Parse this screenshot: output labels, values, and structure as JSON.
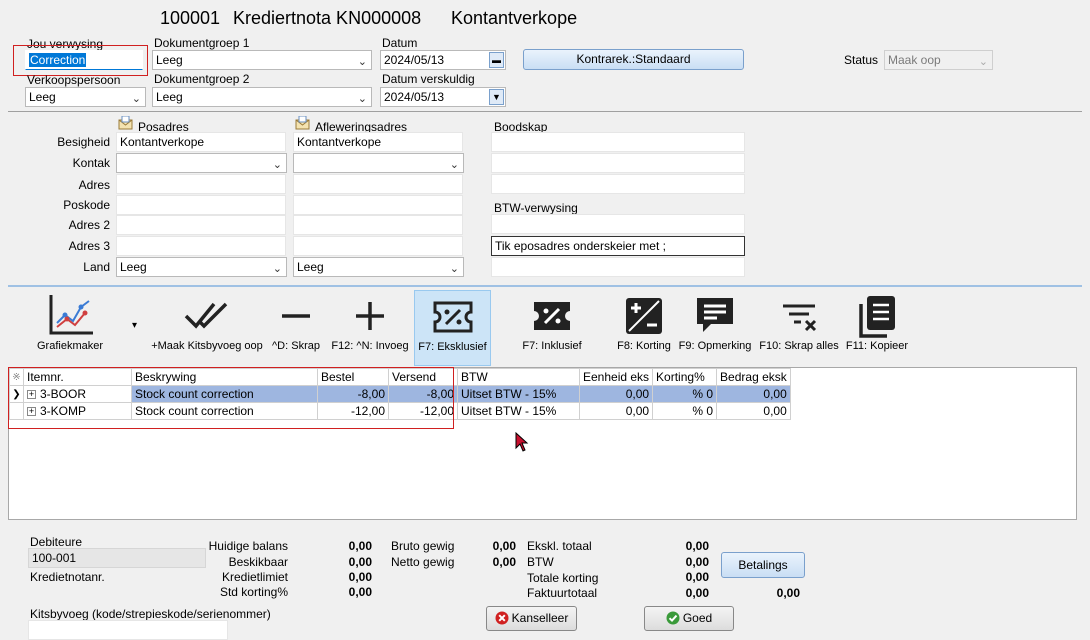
{
  "title": {
    "number": "100001",
    "doc": "Krediertnota KN000008",
    "customer": "Kontantverkope"
  },
  "header": {
    "jou_verwysing_label": "Jou verwysing",
    "jou_verwysing_value": "Correction",
    "verkoopspersoon_label": "Verkoopspersoon",
    "verkoopspersoon_value": "Leeg",
    "dokumentgroep1_label": "Dokumentgroep 1",
    "dokumentgroep1_value": "Leeg",
    "dokumentgroep2_label": "Dokumentgroep 2",
    "dokumentgroep2_value": "Leeg",
    "datum_label": "Datum",
    "datum_value": "2024/05/13",
    "datum_verskuldig_label": "Datum verskuldig",
    "datum_verskuldig_value": "2024/05/13",
    "kontrarek_button": "Kontrarek.:Standaard",
    "status_label": "Status",
    "status_value": "Maak oop"
  },
  "address": {
    "posadres": "Posadres",
    "afleweringsadres": "Afleweringsadres",
    "besigheid_label": "Besigheid",
    "besigheid_post": "Kontantverkope",
    "besigheid_deliv": "Kontantverkope",
    "kontak_label": "Kontak",
    "adres_label": "Adres",
    "poskode_label": "Poskode",
    "adres2_label": "Adres 2",
    "adres3_label": "Adres 3",
    "land_label": "Land",
    "land_post": "Leeg",
    "land_deliv": "Leeg",
    "boodskap_label": "Boodskap",
    "btw_verwysing_label": "BTW-verwysing",
    "eposadres_hint": "Tik eposadres onderskeier met ;"
  },
  "toolbar": [
    {
      "name": "grafiekmaker",
      "label": "Grafiekmaker",
      "icon": "chart-icon"
    },
    {
      "name": "maak-kitsbyvoeg",
      "label": "+Maak Kitsbyvoeg oop",
      "icon": "double-check-icon"
    },
    {
      "name": "skrap",
      "label": "^D: Skrap",
      "icon": "minus-icon"
    },
    {
      "name": "invoeg",
      "label": "F12: ^N: Invoeg",
      "icon": "plus-icon"
    },
    {
      "name": "eksklusief",
      "label": "F7: Eksklusief",
      "icon": "percent-ticket-icon"
    },
    {
      "name": "inklusief",
      "label": "F7: Inklusief",
      "icon": "percent-ticket-filled-icon"
    },
    {
      "name": "korting",
      "label": "F8: Korting",
      "icon": "plus-minus-icon"
    },
    {
      "name": "opmerking",
      "label": "F9: Opmerking",
      "icon": "comment-icon"
    },
    {
      "name": "skrap-alles",
      "label": "F10: Skrap alles",
      "icon": "filter-clear-icon"
    },
    {
      "name": "kopieer",
      "label": "F11: Kopieer",
      "icon": "copy-icon"
    }
  ],
  "grid": {
    "columns": [
      "Itemnr.",
      "Beskrywing",
      "Bestel",
      "Versend",
      "BTW",
      "Eenheid eks",
      "Korting%",
      "Bedrag eksk"
    ],
    "rows": [
      {
        "item": "3-BOOR",
        "desc": "Stock count correction",
        "bestel": "-8,00",
        "versend": "-8,00",
        "btw": "Uitset BTW - 15%",
        "eenheid": "0,00",
        "korting": "% 0",
        "bedrag": "0,00"
      },
      {
        "item": "3-KOMP",
        "desc": "Stock count correction",
        "bestel": "-12,00",
        "versend": "-12,00",
        "btw": "Uitset BTW - 15%",
        "eenheid": "0,00",
        "korting": "% 0",
        "bedrag": "0,00"
      }
    ]
  },
  "footer": {
    "debiteure_label": "Debiteure",
    "debiteure_value": "100-001",
    "kredietnotanr_label": "Kredietnotanr.",
    "kitsbyvoeg_label": "Kitsbyvoeg (kode/strepieskode/serienommer)",
    "huidige_balans_label": "Huidige balans",
    "huidige_balans": "0,00",
    "beskikbaar_label": "Beskikbaar",
    "beskikbaar": "0,00",
    "kredietlimiet_label": "Kredietlimiet",
    "kredietlimiet": "0,00",
    "std_korting_label": "Std korting%",
    "std_korting": "0,00",
    "bruto_label": "Bruto gewig",
    "bruto": "0,00",
    "netto_label": "Netto gewig",
    "netto": "0,00",
    "ekskl_label": "Ekskl. totaal",
    "ekskl": "0,00",
    "btw_label": "BTW",
    "btw": "0,00",
    "totale_korting_label": "Totale korting",
    "totale_korting": "0,00",
    "faktuurtotaal_label": "Faktuurtotaal",
    "faktuurtotaal": "0,00",
    "faktuurtotaal2": "0,00",
    "betalings_button": "Betalings",
    "kanselleer_button": "Kanselleer",
    "goed_button": "Goed"
  },
  "colors": {
    "accent": "#0078d7",
    "highlight_red": "#d02020",
    "selected_row": "#9eb6e0",
    "toolbar_active": "#cce4f7"
  }
}
